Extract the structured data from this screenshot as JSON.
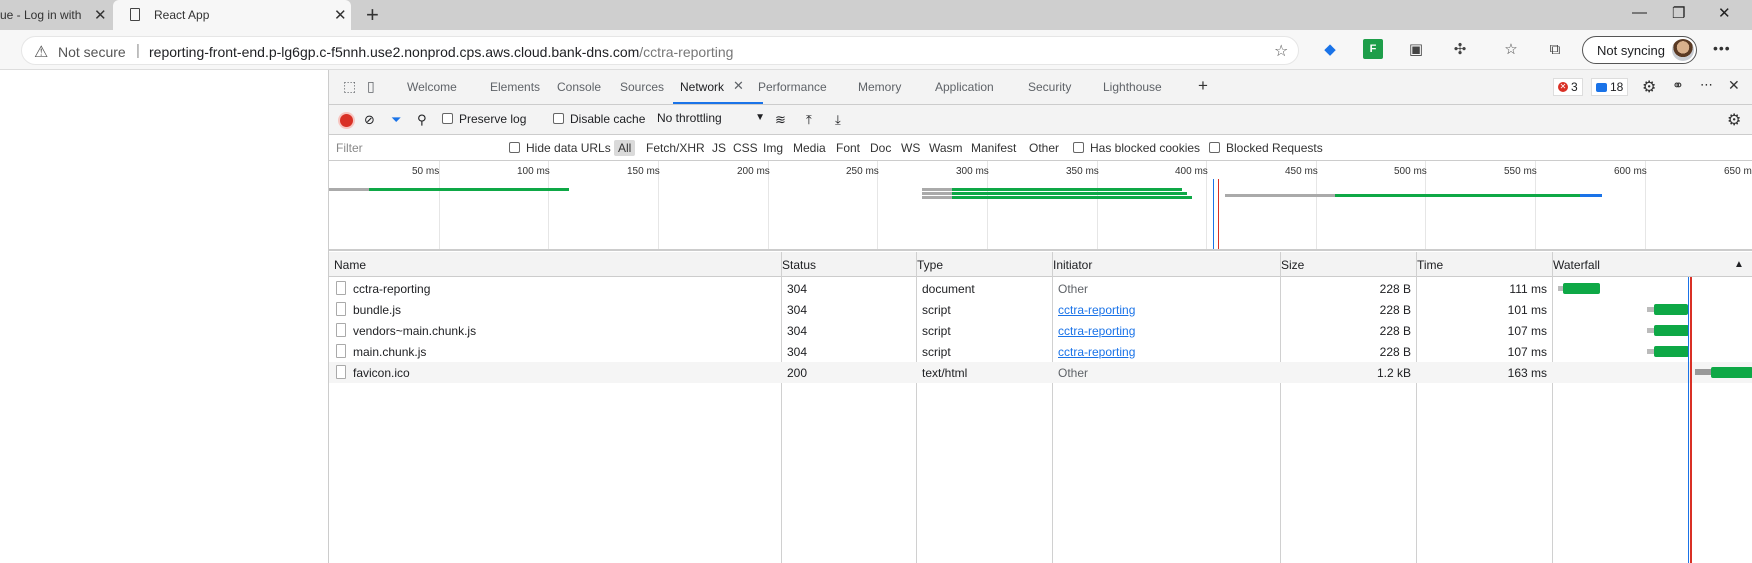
{
  "browser": {
    "tabs": [
      {
        "label": "ue - Log in with a",
        "active": false
      },
      {
        "label": "React App",
        "active": true
      }
    ],
    "address": {
      "security": "Not secure",
      "host": "reporting-front-end.p-lg6gp.c-f5nnh.use2.nonprod.cps.aws.cloud.bank-dns.com",
      "path": "/cctra-reporting"
    },
    "profile": {
      "sync_label": "Not syncing"
    }
  },
  "devtools": {
    "tabs": [
      "Welcome",
      "Elements",
      "Console",
      "Sources",
      "Network",
      "Performance",
      "Memory",
      "Application",
      "Security",
      "Lighthouse"
    ],
    "active_tab": "Network",
    "error_count": "3",
    "message_count": "18",
    "toolbar": {
      "preserve_log": "Preserve log",
      "disable_cache": "Disable cache",
      "throttling": "No throttling"
    },
    "filter": {
      "placeholder": "Filter",
      "hide_data_urls": "Hide data URLs",
      "types": [
        "All",
        "Fetch/XHR",
        "JS",
        "CSS",
        "Img",
        "Media",
        "Font",
        "Doc",
        "WS",
        "Wasm",
        "Manifest",
        "Other"
      ],
      "has_blocked_cookies": "Has blocked cookies",
      "blocked_requests": "Blocked Requests"
    },
    "overview_ticks": [
      "50 ms",
      "100 ms",
      "150 ms",
      "200 ms",
      "250 ms",
      "300 ms",
      "350 ms",
      "400 ms",
      "450 ms",
      "500 ms",
      "550 ms",
      "600 ms",
      "650 m"
    ],
    "table": {
      "columns": [
        "Name",
        "Status",
        "Type",
        "Initiator",
        "Size",
        "Time",
        "Waterfall"
      ],
      "rows": [
        {
          "name": "cctra-reporting",
          "status": "304",
          "type": "document",
          "initiator": "Other",
          "initiator_link": false,
          "size": "228 B",
          "time": "111 ms"
        },
        {
          "name": "bundle.js",
          "status": "304",
          "type": "script",
          "initiator": "cctra-reporting",
          "initiator_link": true,
          "size": "228 B",
          "time": "101 ms"
        },
        {
          "name": "vendors~main.chunk.js",
          "status": "304",
          "type": "script",
          "initiator": "cctra-reporting",
          "initiator_link": true,
          "size": "228 B",
          "time": "107 ms"
        },
        {
          "name": "main.chunk.js",
          "status": "304",
          "type": "script",
          "initiator": "cctra-reporting",
          "initiator_link": true,
          "size": "228 B",
          "time": "107 ms"
        },
        {
          "name": "favicon.ico",
          "status": "200",
          "type": "text/html",
          "initiator": "Other",
          "initiator_link": false,
          "size": "1.2 kB",
          "time": "163 ms"
        }
      ]
    }
  },
  "colors": {
    "accent": "#1a73e8",
    "waterfall_green": "#0ea846",
    "record_red": "#d93025"
  }
}
